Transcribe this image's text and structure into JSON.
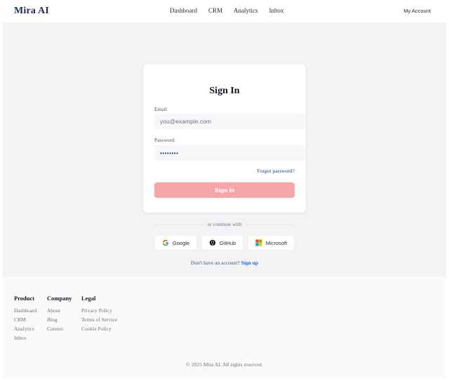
{
  "header": {
    "logo": "Mira AI",
    "nav": [
      "Dashboard",
      "CRM",
      "Analytics",
      "Inbox"
    ],
    "account": "My Account"
  },
  "signin": {
    "title": "Sign In",
    "email_label": "Email",
    "email_placeholder": "you@example.com",
    "password_label": "Password",
    "password_value": "••••••••",
    "forgot": "Forgot password?",
    "button": "Sign In",
    "button_color": "#f5a5a7"
  },
  "social": {
    "divider": "or continue with",
    "google": "Google",
    "github": "GitHub",
    "microsoft": "Microsoft"
  },
  "signup": {
    "prompt": "Don't have an account?",
    "link": "Sign up"
  },
  "footer": {
    "columns": [
      {
        "title": "Product",
        "links": [
          "Dashboard",
          "CRM",
          "Analytics",
          "Inbox"
        ]
      },
      {
        "title": "Company",
        "links": [
          "About",
          "Blog",
          "Careers"
        ]
      },
      {
        "title": "Legal",
        "links": [
          "Privacy Policy",
          "Terms of Service",
          "Cookie Policy"
        ]
      }
    ],
    "copyright": "© 2025 Mira AI. All rights reserved."
  },
  "icons": {
    "google": "google-icon",
    "github": "github-icon",
    "microsoft": "microsoft-icon"
  }
}
